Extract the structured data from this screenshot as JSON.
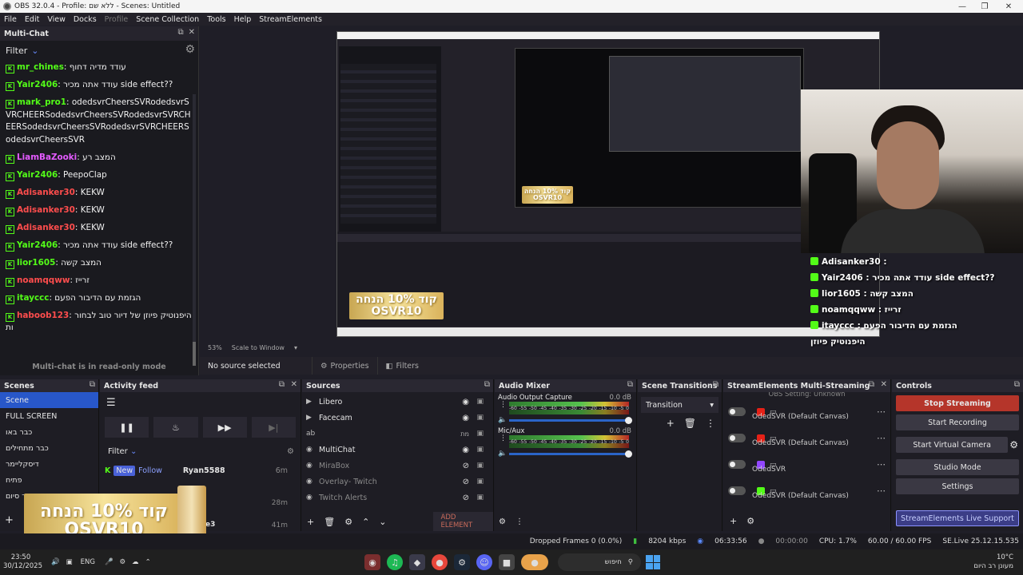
{
  "window": {
    "title": "OBS 32.0.4 - Profile: ללא שם - Scenes: Untitled"
  },
  "menu": [
    "File",
    "Edit",
    "View",
    "Docks",
    "Profile",
    "Scene Collection",
    "Tools",
    "Help",
    "StreamElements"
  ],
  "multichat": {
    "title": "Multi-Chat",
    "filter_label": "Filter",
    "footer": "Multi-chat is in read-only mode",
    "messages": [
      {
        "user": "mr_chines",
        "color": "#53fc18",
        "text": "עודד מדיה דחוף"
      },
      {
        "user": "Yair2406",
        "color": "#53fc18",
        "text": "עודד אתה מכיר side effect??"
      },
      {
        "user": "mark_pro1",
        "color": "#53fc18",
        "text": "odedsvrCheersSVRodedsvrSVRCHEERSodedsvrCheersSVRodedsvrSVRCHEERSodedsvrCheersSVRodedsvrSVRCHEERSodedsvrCheersSVR"
      },
      {
        "user": "LiamBaZooki",
        "color": "#e45bff",
        "text": "המצב רע"
      },
      {
        "user": "Yair2406",
        "color": "#53fc18",
        "text": "PeepoClap"
      },
      {
        "user": "Adisanker30",
        "color": "#ff4d4d",
        "text": "KEKW"
      },
      {
        "user": "Adisanker30",
        "color": "#ff4d4d",
        "text": "KEKW"
      },
      {
        "user": "Adisanker30",
        "color": "#ff4d4d",
        "text": "KEKW"
      },
      {
        "user": "Yair2406",
        "color": "#53fc18",
        "text": "עודד אתה מכיר side effect??"
      },
      {
        "user": "lior1605",
        "color": "#53fc18",
        "text": "המצב קשה"
      },
      {
        "user": "noamqqww",
        "color": "#ff4d4d",
        "text": "זרייז"
      },
      {
        "user": "itayccc",
        "color": "#53fc18",
        "text": "הגזמת עם הדיבור הפעם"
      },
      {
        "user": "haboob123",
        "color": "#ff4d4d",
        "text": "היפנוטיק פיוזן של דיור טוב לבחורות"
      }
    ]
  },
  "preview": {
    "zoom": "53%",
    "scale_mode": "Scale to Window",
    "no_source": "No source selected",
    "properties": "Properties",
    "filters": "Filters",
    "promo_line1": "קוד 10% הנחה",
    "promo_line2": "OSVR10",
    "overlay": [
      {
        "user": "Adisanker30",
        "text": ":"
      },
      {
        "user": "Yair2406",
        "text": ": עודד אתה מכיר side effect??"
      },
      {
        "user": "lior1605",
        "text": ": המצב קשה"
      },
      {
        "user": "noamqqww",
        "text": ": זרייז"
      },
      {
        "user": "itayccc",
        "text": ": הגזמת עם הדיבור הפעם"
      },
      {
        "user": "",
        "text": "היפנוטיק פיוזן"
      }
    ]
  },
  "scenes": {
    "title": "Scenes",
    "items": [
      "Scene",
      "FULL SCREEN",
      "כבר באו",
      "כבר מתחילים",
      "דיסקליימר",
      "פתיח",
      "בקר סיום"
    ]
  },
  "activity": {
    "title": "Activity feed",
    "filter": "Filter",
    "badge_new": "New",
    "badge_follow": "Follow",
    "user": "Ryan5588",
    "time1": "6m",
    "time2": "28m",
    "time3": "41m",
    "extra": "e3"
  },
  "sources": {
    "title": "Sources",
    "add_element": "ADD ELEMENT",
    "items": [
      {
        "name": "Libero",
        "icon": "play-icon",
        "dim": false
      },
      {
        "name": "Facecam",
        "icon": "play-icon",
        "dim": false
      },
      {
        "name": "ab",
        "icon": "text-icon",
        "dim": false,
        "extra": "מת"
      },
      {
        "name": "MultiChat",
        "icon": "browser-icon",
        "dim": false
      },
      {
        "name": "MiraBox",
        "icon": "browser-icon",
        "dim": true
      },
      {
        "name": "Overlay- Twitch",
        "icon": "browser-icon",
        "dim": true
      },
      {
        "name": "Twitch Alerts",
        "icon": "browser-icon",
        "dim": true
      }
    ]
  },
  "mixer": {
    "title": "Audio Mixer",
    "tracks": [
      {
        "name": "Audio Output Capture",
        "db": "0.0 dB"
      },
      {
        "name": "Mic/Aux",
        "db": "0.0 dB"
      }
    ],
    "scale": [
      "-60",
      "-55",
      "-50",
      "-45",
      "-40",
      "-35",
      "-30",
      "-25",
      "-20",
      "-15",
      "-10",
      "-5",
      "0"
    ]
  },
  "transitions": {
    "title": "Scene Transitions",
    "selected": "Transition"
  },
  "se_multi": {
    "title": "StreamElements Multi-Streaming",
    "top_text": "OBS Setting: Unknown",
    "items": [
      {
        "label": "OdedSVR (Default Canvas)",
        "color": "#e62117"
      },
      {
        "label": "OdedSVR (Default Canvas)",
        "color": "#e62117"
      },
      {
        "label": "OdedSVR",
        "color": "#9146ff"
      },
      {
        "label": "OdedSVR (Default Canvas)",
        "color": "#53fc18"
      }
    ]
  },
  "controls": {
    "title": "Controls",
    "stop": "Stop Streaming",
    "record": "Start Recording",
    "vcam": "Start Virtual Camera",
    "studio": "Studio Mode",
    "settings": "Settings",
    "live_support": "StreamElements Live Support"
  },
  "status": {
    "dropped": "Dropped Frames 0 (0.0%)",
    "bitrate": "8204 kbps",
    "live_time": "06:33:56",
    "rec_time": "00:00:00",
    "cpu": "CPU: 1.7%",
    "fps": "60.00 / 60.00 FPS",
    "version": "SE.Live 25.12.15.535"
  },
  "taskbar": {
    "time": "23:50",
    "date": "30/12/2025",
    "lang": "ENG",
    "search": "חיפוש",
    "weather_temp": "10°C",
    "weather_text": "מעונן רב היום"
  }
}
